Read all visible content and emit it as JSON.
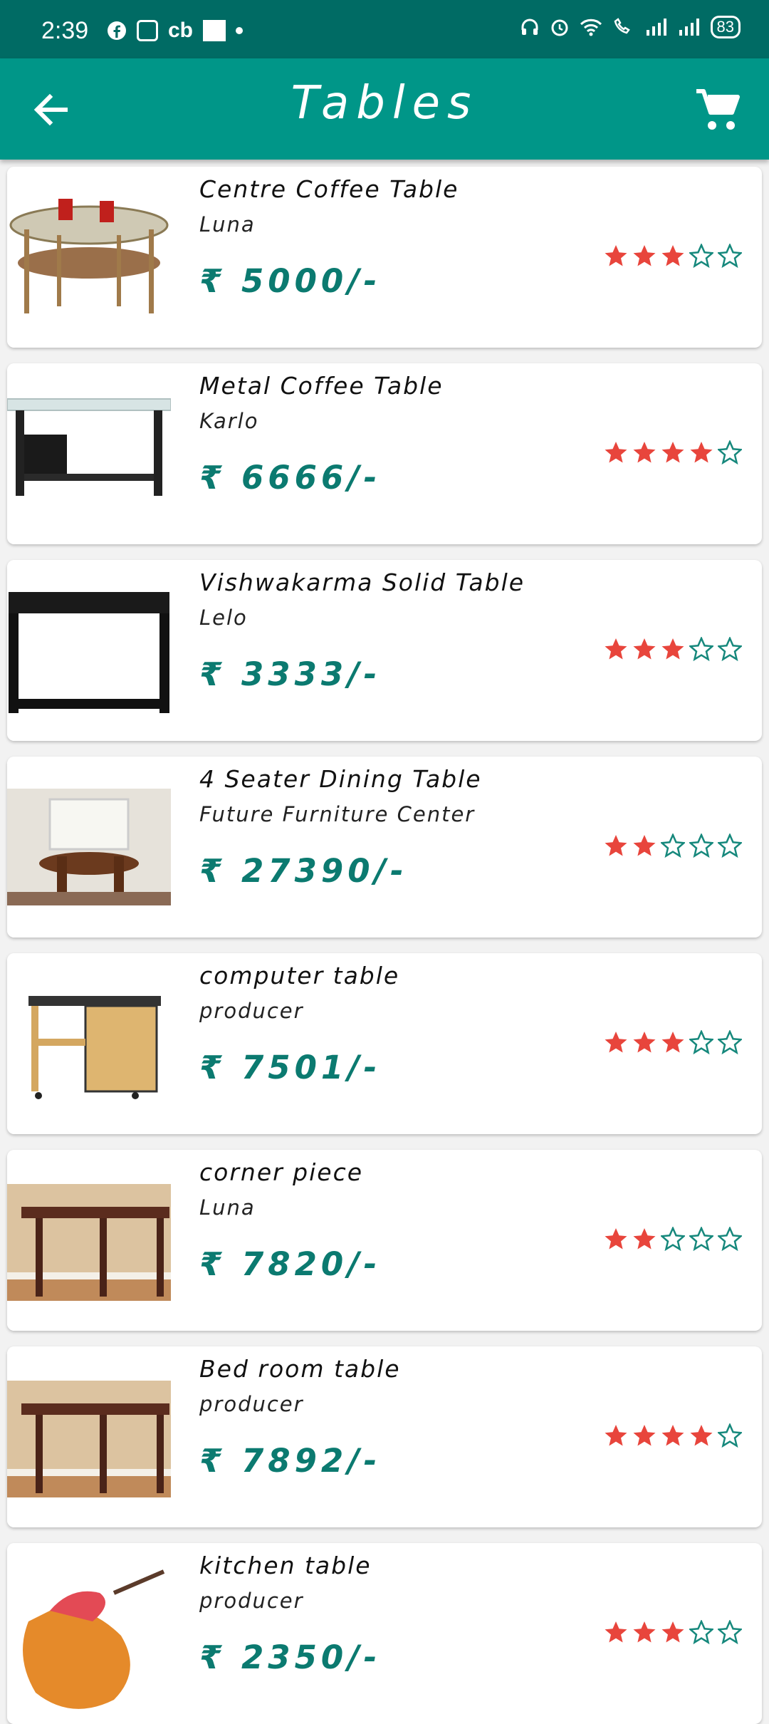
{
  "status_bar": {
    "time": "2:39",
    "battery": "83",
    "left_icons": [
      "facebook-icon",
      "app-grid-icon",
      "cb-icon",
      "news-icon",
      "dot-icon"
    ],
    "right_icons": [
      "headset-icon",
      "alarm-icon",
      "wifi-icon",
      "wifi-call-icon",
      "signal-icon",
      "signal-icon"
    ]
  },
  "app_bar": {
    "title": "Tables",
    "back_icon": "arrow-back-icon",
    "cart_icon": "cart-icon",
    "color": "#009688"
  },
  "accent": {
    "price": "#0b7a70",
    "star": "#e8453c",
    "star_empty": "#16887c"
  },
  "products": [
    {
      "name": "Centre Coffee Table",
      "brand": "Luna",
      "price": "₹ 5000/-",
      "rating": 3
    },
    {
      "name": "Metal Coffee Table",
      "brand": "Karlo",
      "price": "₹ 6666/-",
      "rating": 4
    },
    {
      "name": "Vishwakarma Solid Table",
      "brand": "Lelo",
      "price": "₹ 3333/-",
      "rating": 3
    },
    {
      "name": "4 Seater Dining Table",
      "brand": "Future Furniture Center",
      "price": "₹ 27390/-",
      "rating": 2
    },
    {
      "name": "computer table",
      "brand": "producer",
      "price": "₹ 7501/-",
      "rating": 3
    },
    {
      "name": "corner piece",
      "brand": "Luna",
      "price": "₹ 7820/-",
      "rating": 2
    },
    {
      "name": "Bed room table",
      "brand": "producer",
      "price": "₹ 7892/-",
      "rating": 4
    },
    {
      "name": "kitchen table",
      "brand": "producer",
      "price": "₹ 2350/-",
      "rating": 3
    }
  ]
}
